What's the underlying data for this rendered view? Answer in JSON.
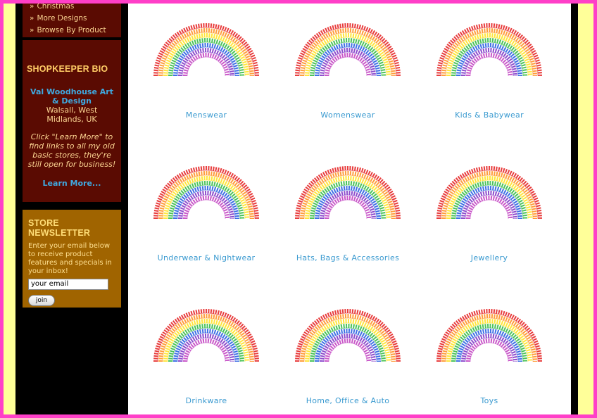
{
  "nav": {
    "items": [
      {
        "label": "Christmas"
      },
      {
        "label": "More Designs"
      },
      {
        "label": "Browse By Product"
      }
    ],
    "chevron": "»"
  },
  "bio": {
    "heading": "SHOPKEEPER BIO",
    "name": "Val Woodhouse Art & Design",
    "location": "Walsall, West Midlands, UK",
    "description": "Click \"Learn More\" to find links to all my old basic stores, they're still open for business!",
    "link": "Learn More..."
  },
  "newsletter": {
    "heading": "STORE NEWSLETTER",
    "text": "Enter your email below to receive product features and specials in your inbox!",
    "email_value": "your email",
    "join_label": "join"
  },
  "products": [
    {
      "label": "Menswear",
      "icon": "rainbow-icon"
    },
    {
      "label": "Womenswear",
      "icon": "rainbow-icon"
    },
    {
      "label": "Kids & Babywear",
      "icon": "rainbow-icon"
    },
    {
      "label": "Underwear & Nightwear",
      "icon": "rainbow-icon"
    },
    {
      "label": "Hats, Bags & Accessories",
      "icon": "rainbow-icon"
    },
    {
      "label": "Jewellery",
      "icon": "rainbow-icon"
    },
    {
      "label": "Drinkware",
      "icon": "rainbow-icon"
    },
    {
      "label": "Home, Office & Auto",
      "icon": "rainbow-icon"
    },
    {
      "label": "Toys",
      "icon": "rainbow-icon"
    }
  ],
  "colors": {
    "border": "#ff3fc8",
    "outer": "#ffff99",
    "sidebar_dark": "#5a0b02",
    "newsletter": "#a06400",
    "link": "#3a9ad0",
    "rainbow": [
      "#e41b1b",
      "#ff8c1a",
      "#ffe11a",
      "#2db83d",
      "#1f58e0",
      "#7a2fc4",
      "#c03bc0"
    ]
  }
}
